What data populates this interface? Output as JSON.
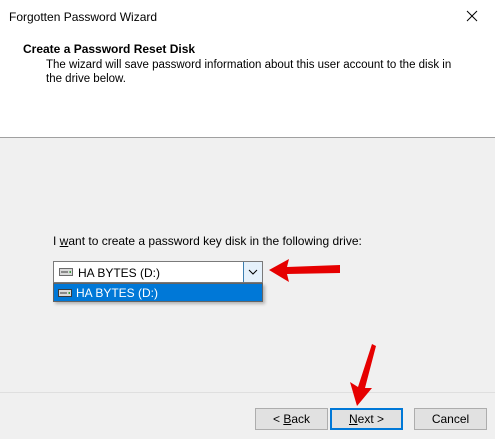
{
  "window": {
    "title": "Forgotten Password Wizard"
  },
  "header": {
    "title": "Create a Password Reset Disk",
    "description": "The wizard will save password information about this user account to the disk in the drive below."
  },
  "body": {
    "drive_label_pre": "I ",
    "drive_label_accel": "w",
    "drive_label_post": "ant to create a password key disk in the following drive:",
    "selected_drive": "HA BYTES (D:)",
    "options": [
      "HA BYTES (D:)"
    ]
  },
  "buttons": {
    "back_accel": "B",
    "back_rest": "ack",
    "back_prefix": "< ",
    "next_accel": "N",
    "next_rest": "ext",
    "next_suffix": " >",
    "cancel": "Cancel"
  },
  "colors": {
    "accent": "#0078d7",
    "arrow": "#e60000"
  },
  "icons": [
    "close-icon",
    "drive-icon",
    "chevron-down-icon"
  ]
}
